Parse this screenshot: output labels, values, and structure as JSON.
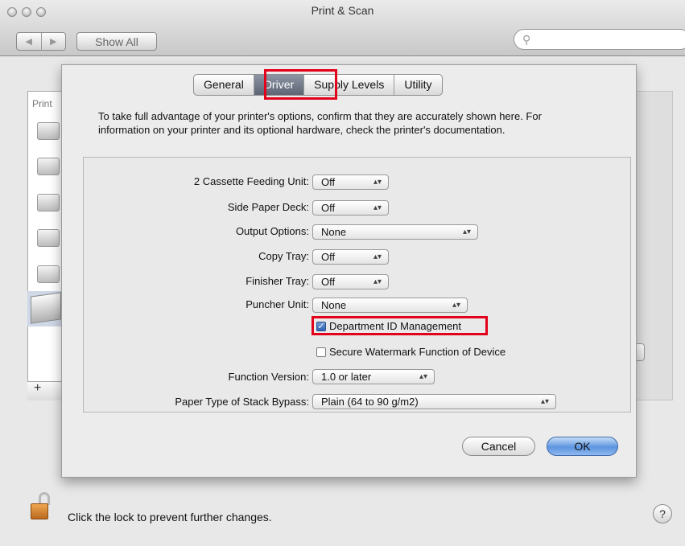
{
  "window": {
    "title": "Print & Scan",
    "show_all": "Show All",
    "search_placeholder": ""
  },
  "sidebar": {
    "label": "Print"
  },
  "tabs": [
    {
      "label": "General",
      "active": false
    },
    {
      "label": "Driver",
      "active": true
    },
    {
      "label": "Supply Levels",
      "active": false
    },
    {
      "label": "Utility",
      "active": false
    }
  ],
  "intro_text": "To take full advantage of your printer's options, confirm that they are accurately shown here. For information on your printer and its optional hardware, check the printer's documentation.",
  "options": {
    "cassette": {
      "label": "2 Cassette Feeding Unit:",
      "value": "Off"
    },
    "side_deck": {
      "label": "Side Paper Deck:",
      "value": "Off"
    },
    "output": {
      "label": "Output Options:",
      "value": "None"
    },
    "copy_tray": {
      "label": "Copy Tray:",
      "value": "Off"
    },
    "finisher_tray": {
      "label": "Finisher Tray:",
      "value": "Off"
    },
    "puncher": {
      "label": "Puncher Unit:",
      "value": "None"
    },
    "dept_id": {
      "label": "Department ID Management",
      "checked": true
    },
    "watermark": {
      "label": "Secure Watermark Function of Device",
      "checked": false
    },
    "function_version": {
      "label": "Function Version:",
      "value": "1.0 or later"
    },
    "paper_type": {
      "label": "Paper Type of Stack Bypass:",
      "value": "Plain (64 to 90 g/m2)"
    }
  },
  "buttons": {
    "cancel": "Cancel",
    "ok": "OK"
  },
  "footer": {
    "lock_text": "Click the lock to prevent further changes.",
    "help": "?"
  },
  "colors": {
    "highlight": "#e2001a",
    "ok_blue": "#5c95e0"
  }
}
